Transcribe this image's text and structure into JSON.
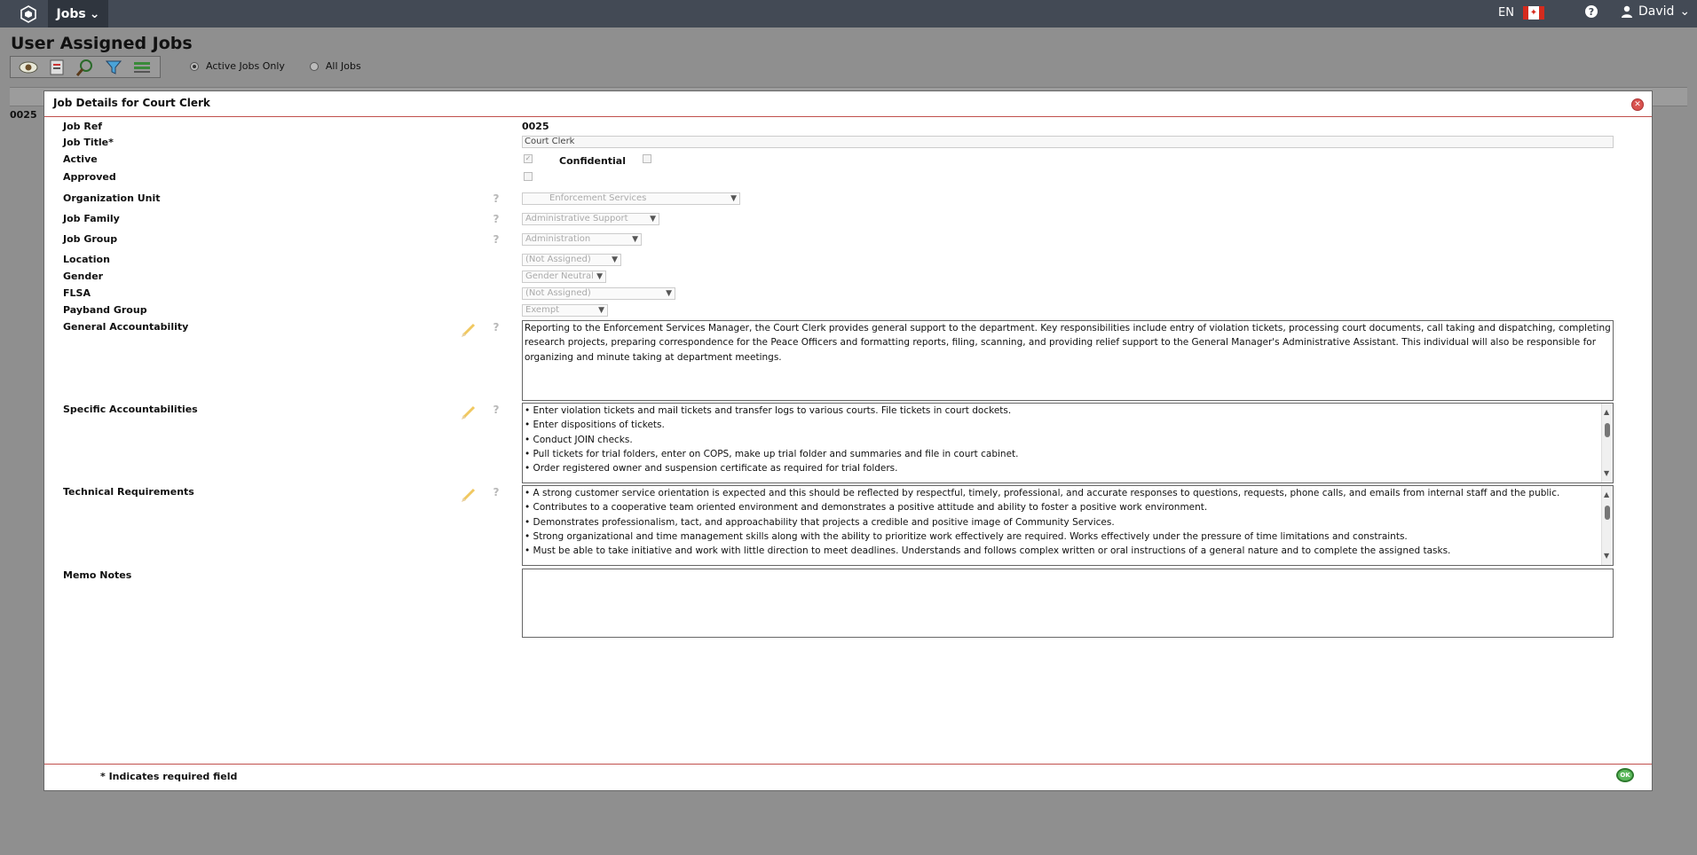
{
  "topbar": {
    "menu_label": "Jobs",
    "language": "EN",
    "user_name": "David"
  },
  "page": {
    "title": "User Assigned Jobs",
    "radio_active": "Active Jobs Only",
    "radio_all": "All Jobs",
    "background_row_ref": "0025"
  },
  "dialog": {
    "title": "Job Details for Court Clerk",
    "labels": {
      "job_ref": "Job Ref",
      "job_title": "Job Title*",
      "active": "Active",
      "confidential": "Confidential",
      "approved": "Approved",
      "org_unit": "Organization Unit",
      "job_family": "Job Family",
      "job_group": "Job Group",
      "location": "Location",
      "gender": "Gender",
      "flsa": "FLSA",
      "payband": "Payband Group",
      "general": "General Accountability",
      "specific": "Specific Accountabilities",
      "technical": "Technical Requirements",
      "memo": "Memo Notes"
    },
    "values": {
      "job_ref": "0025",
      "job_title": "Court Clerk",
      "active_checked": true,
      "confidential_checked": false,
      "approved_checked": false,
      "org_unit": "Enforcement Services",
      "job_family": "Administrative Support",
      "job_group": "Administration",
      "location": "(Not Assigned)",
      "gender": "Gender Neutral",
      "flsa": "(Not Assigned)",
      "payband": "Exempt",
      "general_accountability": [
        "Reporting to the Enforcement Services Manager, the Court Clerk provides general support to the department. Key responsibilities include entry of violation tickets, processing court documents, call taking and dispatching, completing research projects, preparing correspondence for the Peace Officers and formatting reports, filing, scanning, and providing relief support to the General Manager's Administrative Assistant. This individual will also be responsible for organizing and minute taking at department meetings."
      ],
      "specific_accountabilities": [
        "• Enter violation tickets and mail tickets and transfer logs to various courts. File tickets in court dockets.",
        "• Enter dispositions of tickets.",
        "• Conduct JOIN checks.",
        "• Pull tickets for trial folders, enter on COPS, make up trial folder and summaries and file in court cabinet.",
        "• Order registered owner and suspension certificate as required for trial folders."
      ],
      "technical_requirements": [
        "• A strong customer service orientation is expected and this should be reflected by respectful, timely, professional, and accurate responses to questions, requests, phone calls, and emails from internal staff and the public.",
        "• Contributes to a cooperative team oriented environment and demonstrates a positive attitude and ability to foster a positive work environment.",
        "• Demonstrates professionalism, tact, and approachability that projects a credible and positive image of Community Services.",
        "• Strong organizational and time management skills along with the ability to prioritize work effectively are required. Works effectively under the pressure of time limitations and constraints.",
        "• Must be able to take initiative and work with little direction to meet deadlines. Understands and follows complex written or oral instructions of a general nature and to complete the assigned tasks."
      ],
      "memo_notes": ""
    },
    "footer_note": "* Indicates required field",
    "ok_label": "OK"
  },
  "colors": {
    "topbar": "#434a55",
    "accent_rule": "#c0504d",
    "overlay": "#8f8f8f"
  }
}
